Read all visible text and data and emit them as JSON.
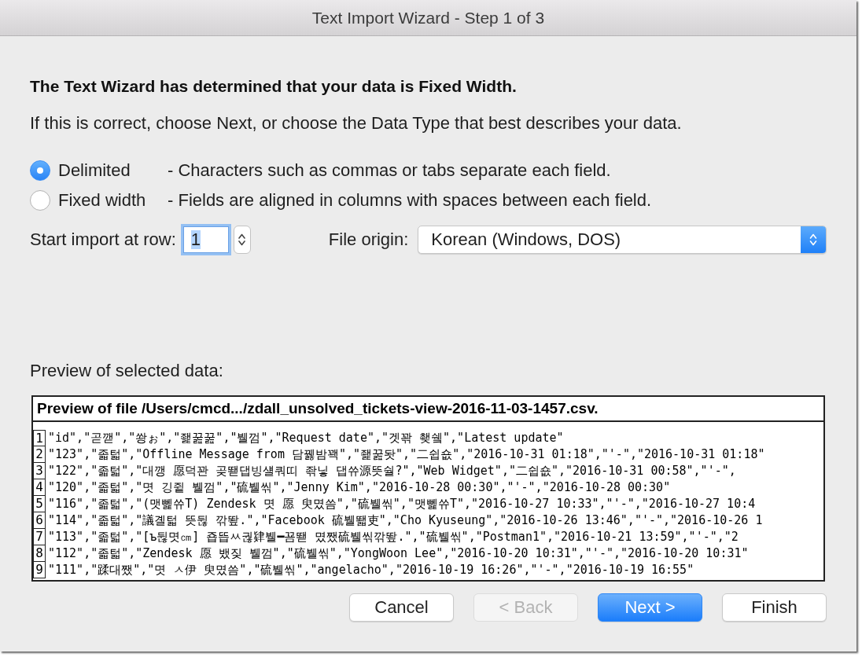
{
  "window": {
    "title": "Text Import Wizard - Step 1 of 3"
  },
  "heading": "The Text Wizard has determined that your data is Fixed Width.",
  "instruction": "If this is correct, choose Next, or choose the Data Type that best describes your data.",
  "data_types": [
    {
      "label": "Delimited",
      "description": "- Characters such as commas or tabs separate each field.",
      "selected": true
    },
    {
      "label": "Fixed width",
      "description": "- Fields are aligned in columns with spaces between each field.",
      "selected": false
    }
  ],
  "start_import": {
    "label": "Start import at row:",
    "value": "1",
    "focused": true
  },
  "file_origin": {
    "label": "File origin:",
    "value": "Korean (Windows, DOS)"
  },
  "preview": {
    "label": "Preview of selected data:",
    "header": "Preview of file /Users/cmcd.../zdall_unsolved_tickets-view-2016-11-03-1457.csv.",
    "rows": [
      {
        "number": "1",
        "text": "\"id\",\"곧깯\",\"쐉ぉ\",\"좵꿆꿆\",\"뷀껌\",\"Request date\",\"겟꽊 쵖쉨\",\"Latest update\""
      },
      {
        "number": "2",
        "text": "\"123\",\"졻턻\",\"Offline Message from 담꿿밤꽥\",\"좵꿆돳\",\"二쉽숎\",\"2016-10-31 01:18\",\"'-\",\"2016-10-31 01:18\""
      },
      {
        "number": "3",
        "text": "\"122\",\"졻턻\",\"대깽 愿덕꽌 곶뙏댑빙섈쿼띠 좎닣 댑쓔源뜻숼?\",\"Web Widget\",\"二쉽숎\",\"2016-10-31 00:58\",\"'-\","
      },
      {
        "number": "4",
        "text": "\"120\",\"졻턻\",\"몃 깅쥩 뷀껌\",\"硫뷀씪\",\"Jenny Kim\",\"2016-10-28 00:30\",\"'-\",\"2016-10-28 00:30\""
      },
      {
        "number": "5",
        "text": "\"116\",\"졻턻\",\"(맷뻹쓔T) Zendesk 몃 愿 臾몄씀\",\"硫뷀씪\",\"맷뻹쓔T\",\"2016-10-27 10:33\",\"'-\",\"2016-10-27 10:4"
      },
      {
        "number": "6",
        "text": "\"114\",\"졻턻\",\"議곌턻 뜻뒪 깎뙆.\",\"Facebook 硫뷀뙓吏\",\"Cho Kyuseung\",\"2016-10-26 13:46\",\"'-\",\"2016-10-26 1"
      },
      {
        "number": "7",
        "text": "\"113\",\"졻턻\",\"[ъ뒪몃㎝] 죱뜹ㅆ궎肄뷀━꾬뙏 몄쨌硫뷀씪깎뙆.\",\"硫뷀씪\",\"Postman1\",\"2016-10-21 13:59\",\"'-\",\"2"
      },
      {
        "number": "8",
        "text": "\"112\",\"졻턻\",\"Zendesk 愿 뱄짖 뷀껌\",\"硫뷀씪\",\"YongWoon Lee\",\"2016-10-20 10:31\",\"'-\",\"2016-10-20 10:31\""
      },
      {
        "number": "9",
        "text": "\"111\",\"蹂대쨌\",\"몃 ㅅ伊 臾몄씀\",\"硫뷀씪\",\"angelacho\",\"2016-10-19 16:26\",\"'-\",\"2016-10-19 16:55\""
      }
    ]
  },
  "buttons": [
    {
      "label": "Cancel",
      "kind": "normal",
      "disabled": false
    },
    {
      "label": "< Back",
      "kind": "normal",
      "disabled": true
    },
    {
      "label": "Next >",
      "kind": "default",
      "disabled": false
    },
    {
      "label": "Finish",
      "kind": "normal",
      "disabled": false
    }
  ]
}
